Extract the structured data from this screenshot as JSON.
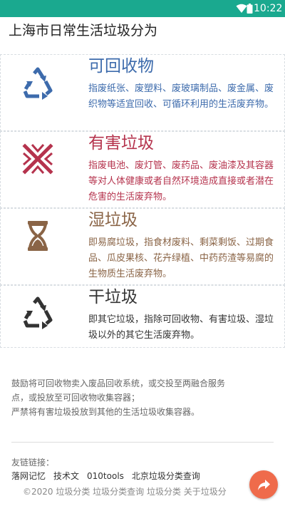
{
  "status_bar": {
    "time": "10:22",
    "color": "#1aa98f"
  },
  "page_title": "上海市日常生活垃圾分为",
  "categories": [
    {
      "title": "可回收物",
      "description": "指废纸张、废塑料、废玻璃制品、废金属、废织物等适宜回收、可循环利用的生活废弃物。",
      "color": "#3d6bac",
      "icon": "recycle-icon"
    },
    {
      "title": "有害垃圾",
      "description": "指废电池、废灯管、废药品、废油漆及其容器等对人体健康或者自然环境造成直接或者潜在危害的生活废弃物。",
      "color": "#b5334d",
      "icon": "hazard-cross-icon"
    },
    {
      "title": "湿垃圾",
      "description": "即易腐垃圾，指食材废料、剩菜剩饭、过期食品、瓜皮果核、花卉绿植、中药药渣等易腐的生物质生活废弃物。",
      "color": "#8a6446",
      "icon": "hourglass-icon"
    },
    {
      "title": "干垃圾",
      "description": "即其它垃圾，指除可回收物、有害垃圾、湿垃圾以外的其它生活废弃物。",
      "color": "#333333",
      "icon": "dark-recycle-icon"
    }
  ],
  "notes": [
    "鼓励将可回收物卖入废品回收系统，或交投至两融合服务",
    "点，或投放至可回收物收集容器；",
    "严禁将有害垃圾投放到其他的生活垃圾收集容器。"
  ],
  "links_label": "友链链接：",
  "links": [
    "落网记忆",
    "技术文",
    "010tools",
    "北京垃圾分类查询"
  ],
  "copyright": "©2020 垃圾分类 垃圾分类查询 垃圾分类 关于垃圾分",
  "fab": {
    "icon": "share-icon",
    "color": "#ef6b4b"
  }
}
